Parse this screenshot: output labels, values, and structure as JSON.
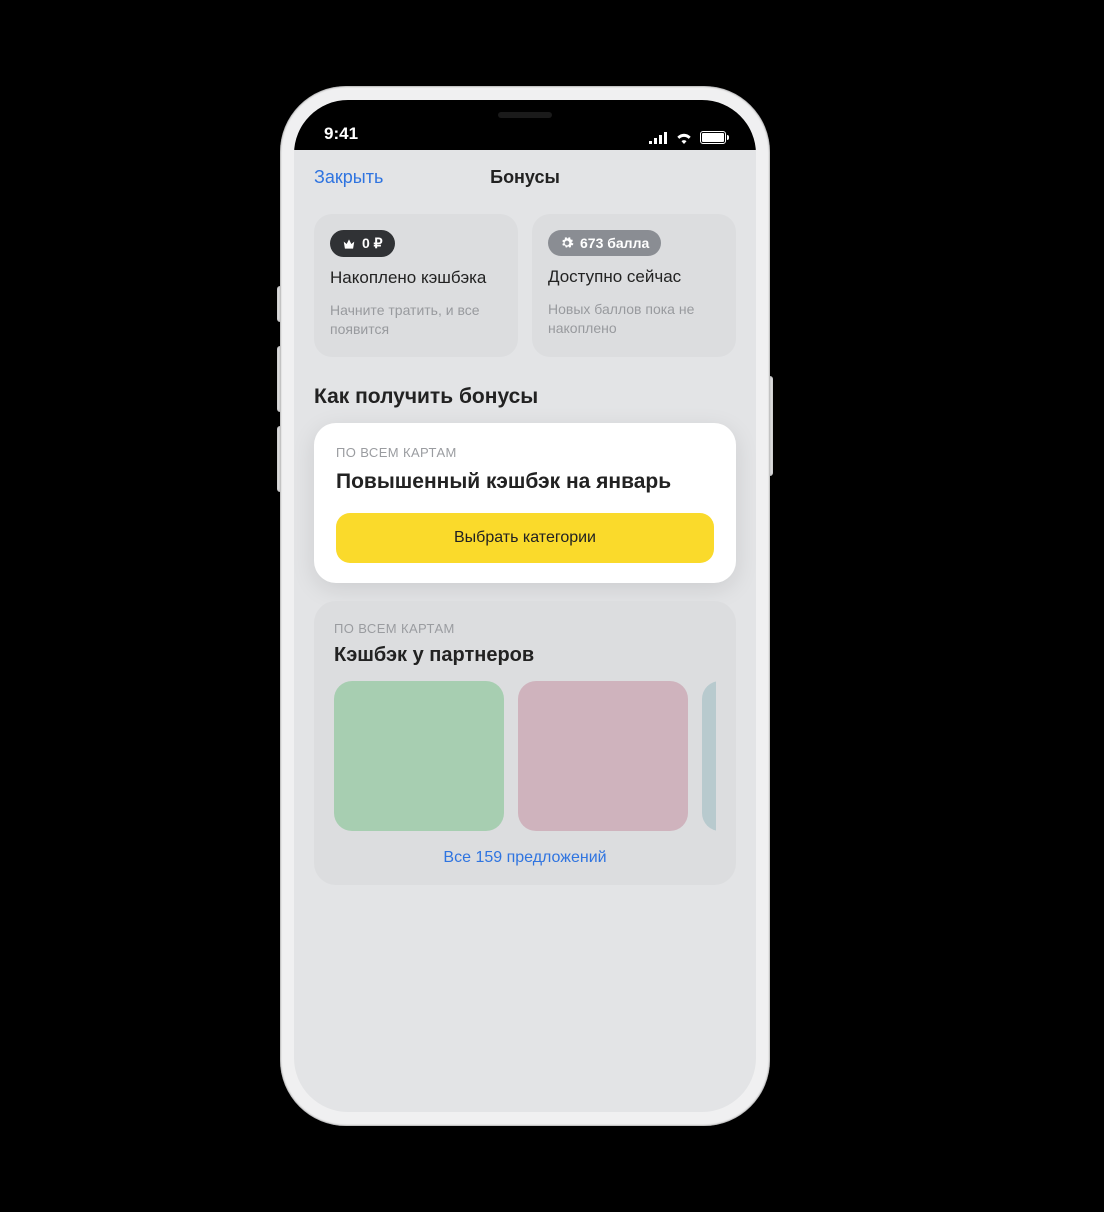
{
  "status": {
    "time": "9:41"
  },
  "nav": {
    "close": "Закрыть",
    "title": "Бонусы"
  },
  "stats": {
    "cashback": {
      "badge": "0 ₽",
      "title": "Накоплено кэшбэка",
      "sub": "Начните тратить, и все появится"
    },
    "points": {
      "badge": "673 балла",
      "title": "Доступно сейчас",
      "sub": "Новых баллов пока не накоплено"
    }
  },
  "section_how_title": "Как получить бонусы",
  "promo": {
    "overline": "ПО ВСЕМ КАРТАМ",
    "title": "Повышенный кэшбэк на январь",
    "button": "Выбрать категории"
  },
  "partners": {
    "overline": "ПО ВСЕМ КАРТАМ",
    "title": "Кэшбэк у партнеров",
    "tiles": [
      {
        "color": "#a7ceb1"
      },
      {
        "color": "#cfb3bd"
      },
      {
        "color": "#b8cace"
      }
    ],
    "more": "Все 159 предложений",
    "offer_count": 159
  },
  "colors": {
    "accent_blue": "#2f74e0",
    "accent_yellow": "#fada2b",
    "bg_screen": "#e3e4e6",
    "bg_card_grey": "#dcdddf",
    "text_muted": "#9a9ca0"
  }
}
